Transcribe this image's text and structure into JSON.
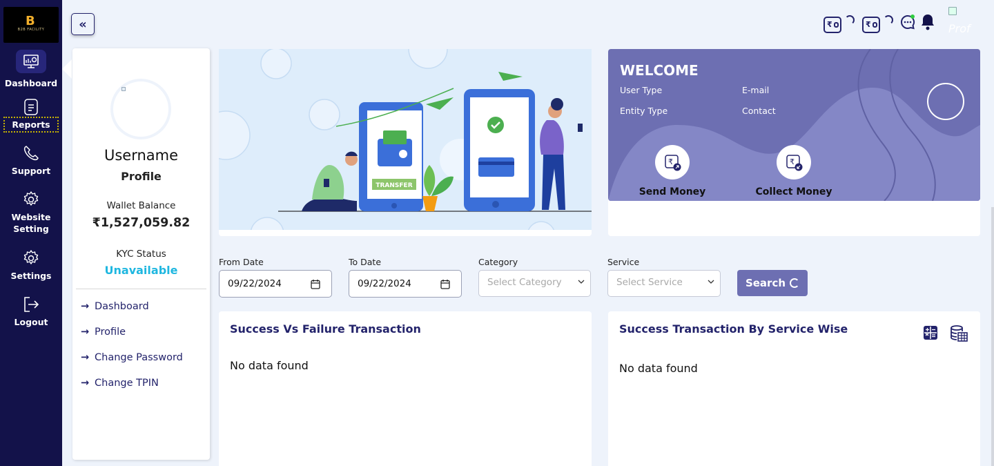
{
  "logo": {
    "letter": "B",
    "tagline": "B2B FACILITY"
  },
  "nav": [
    {
      "label": "Dashboard",
      "icon": "dashboard-icon"
    },
    {
      "label": "Reports",
      "icon": "reports-icon"
    },
    {
      "label": "Support",
      "icon": "phone-icon"
    },
    {
      "label": "Website Setting",
      "icon": "gear-icon"
    },
    {
      "label": "Settings",
      "icon": "gear-icon"
    },
    {
      "label": "Logout",
      "icon": "logout-icon"
    }
  ],
  "topbar": {
    "collapse_icon": "«",
    "wallet_symbol": "₹",
    "profile_img_alt": "Prof"
  },
  "profile": {
    "username": "Username",
    "subtitle": "Profile",
    "wallet_label": "Wallet Balance",
    "wallet_value": "₹1,527,059.82",
    "kyc_label": "KYC Status",
    "kyc_value": "Unavailable",
    "links": [
      "Dashboard",
      "Profile",
      "Change Password",
      "Change TPIN"
    ]
  },
  "banner": {
    "tag": "TRANSFER"
  },
  "welcome": {
    "title": "WELCOME",
    "user_type": "User Type",
    "email": "E-mail",
    "entity_type": "Entity Type",
    "contact": "Contact",
    "send": "Send Money",
    "collect": "Collect Money"
  },
  "filters": {
    "from_label": "From Date",
    "from_value": "09/22/2024",
    "to_label": "To Date",
    "to_value": "09/22/2024",
    "category_label": "Category",
    "category_placeholder": "Select Category",
    "service_label": "Service",
    "service_placeholder": "Select Service",
    "search_label": "Search"
  },
  "panels": {
    "left_title": "Success Vs Failure Transaction",
    "left_empty": "No data found",
    "right_title": "Success Transaction By Service Wise",
    "right_empty": "No data found"
  },
  "colors": {
    "rail": "#13124a",
    "accent": "#6d6fb2",
    "title": "#23236b",
    "kyc": "#1fb7e0"
  }
}
